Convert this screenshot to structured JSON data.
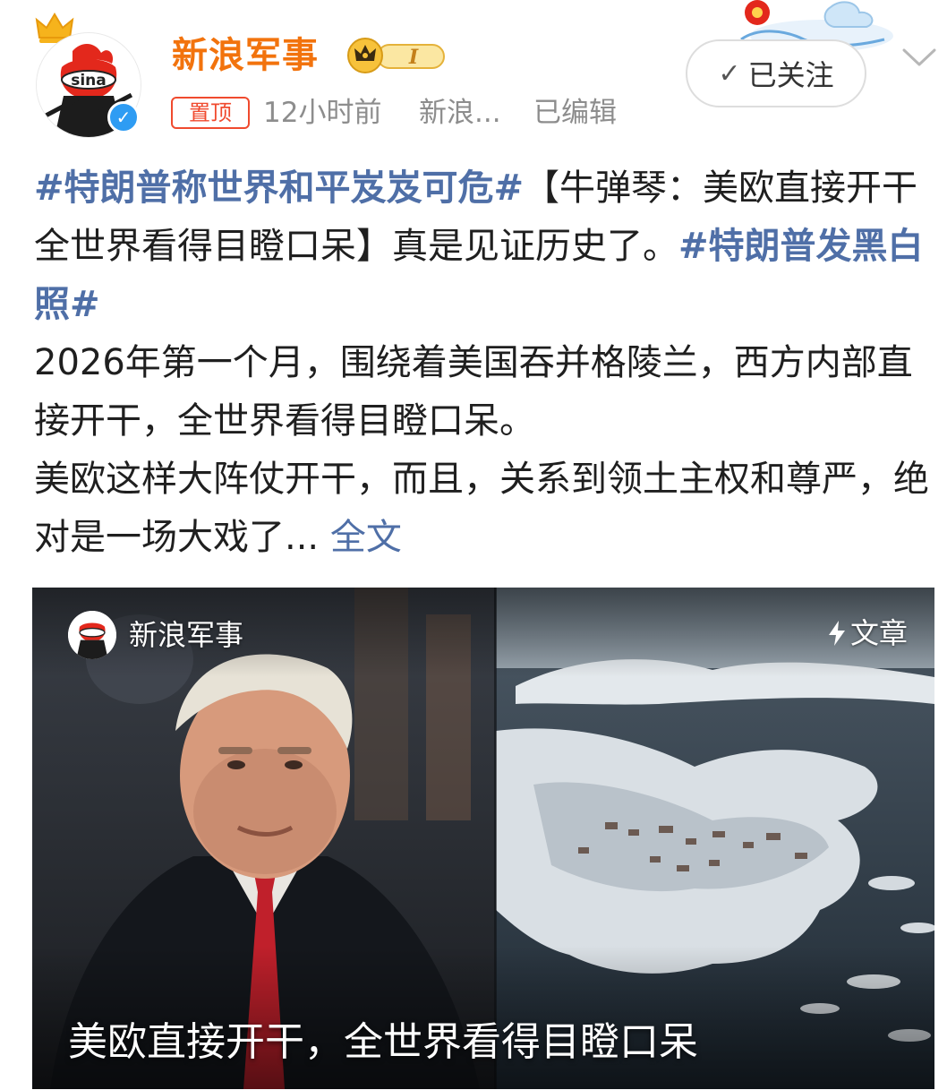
{
  "header": {
    "username": "新浪军事",
    "level_badge": "I",
    "pinned_label": "置顶",
    "time": "12小时前",
    "source": "新浪...",
    "edited": "已编辑",
    "follow_label": "已关注",
    "brand_color": "#f2730d",
    "avatar_icon": "sina-logo",
    "verified_icon": "verified-check"
  },
  "post": {
    "line1_tag": "#特朗普称世界和平岌岌可危#",
    "line1_text": "【牛弹琴：美欧直接开干全世界看得目瞪口呆】真是见证历史了。",
    "line1_tag2": "#特朗普发黑白照#",
    "para2": "2026年第一个月，围绕着美国吞并格陵兰，西方内部直接开干，全世界看得目瞪口呆。",
    "para3": "美欧这样大阵仗开干，而且，关系到领土主权和尊严，绝对是一场大戏了...",
    "full_text_link": "全文",
    "link_color": "#4f6fa7"
  },
  "media": {
    "author": "新浪军事",
    "type_label": "文章",
    "type_icon": "lightning-icon",
    "caption": "美欧直接开干，全世界看得目瞪口呆"
  }
}
